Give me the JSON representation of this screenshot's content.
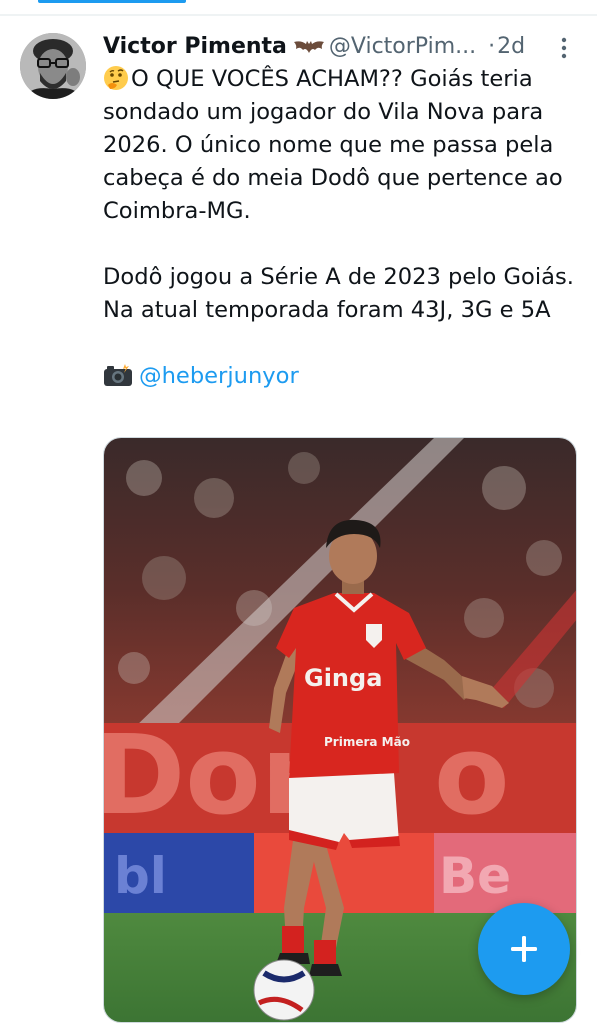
{
  "tweet": {
    "display_name": "Victor Pimenta",
    "handle": "@VictorPim...",
    "separator": "·",
    "age": "2d",
    "text_line1": "O QUE VOCÊS ACHAM?? Goiás teria sondado um jogador do Vila Nova para 2026. O único nome que me passa pela cabeça é do meia Dodô que pertence ao Coimbra-MG.",
    "text_line2": "Dodô jogou a Série A de 2023 pelo Goiás. Na atual temporada foram 43J, 3G e 5A",
    "photo_credit": "@heberjunyor",
    "image_texts": {
      "sponsor": "Ginga",
      "shorts_sponsor": "Primera Mão"
    }
  },
  "icons": {
    "name_badge": "bat-emoji-icon",
    "thinking": "thinking-face-emoji-icon",
    "camera": "camera-with-flash-emoji-icon",
    "more": "more-vertical-icon",
    "compose": "plus-icon"
  },
  "colors": {
    "accent": "#1d9bf0",
    "text": "#0f1419",
    "secondary": "#536471",
    "divider": "#eff3f4"
  }
}
